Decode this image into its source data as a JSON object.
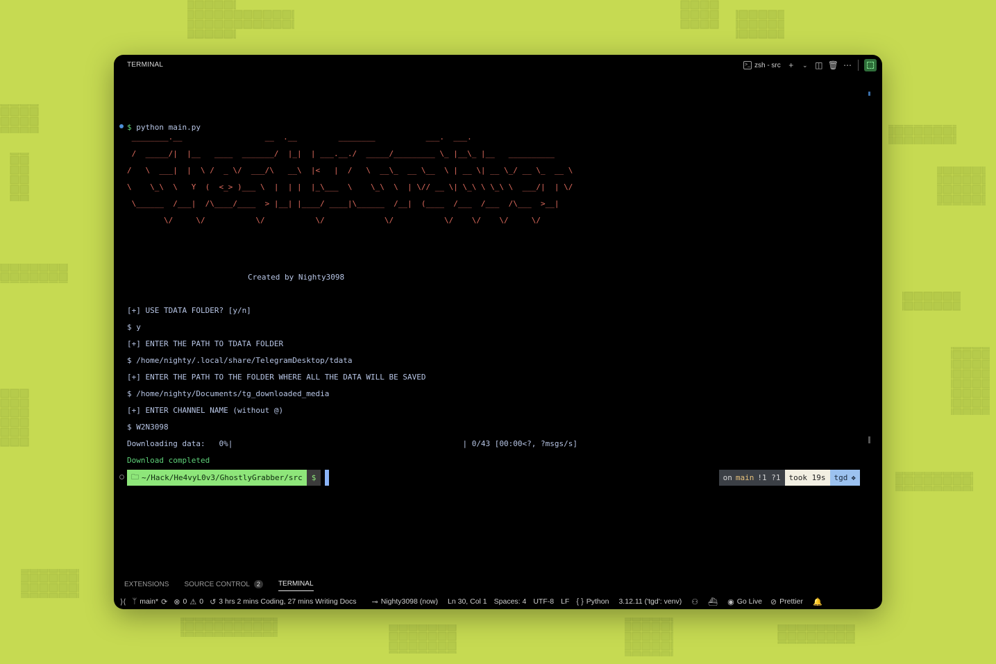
{
  "window": {
    "title": "TERMINAL"
  },
  "toolbar": {
    "terminal_name": "zsh - src",
    "add_icon": "plus-icon",
    "dropdown_icon": "chevron-down-icon",
    "split_icon": "split-icon",
    "trash_icon": "trash-icon",
    "more_icon": "more-icon",
    "maximize_icon": "maximize-icon"
  },
  "terminal": {
    "command_prompt": "$ ",
    "command": "python main.py",
    "ascii_art": " ________.__                  __  .__         ________           ___.  ___.\n /  _____/|  |__   ____  _______/  |_|  | ___.__./  _____/_________ \\_ |__\\_ |__   __________\n/   \\  ___|  |  \\ /  _ \\/  ___/\\   __\\  |<   |  /   \\  __\\_  __ \\__  \\ | __ \\| __ \\_/ __ \\_  __ \\\n\\    \\_\\  \\   Y  (  <_> )___ \\  |  | |  |_\\___  \\    \\_\\  \\  | \\// __ \\| \\_\\ \\ \\_\\ \\  ___/|  | \\/\n \\______  /___|  /\\____/____  > |__| |____/ ____|\\______  /__|  (____  /___  /___  /\\___  >__|\n        \\/     \\/           \\/           \\/             \\/           \\/    \\/    \\/     \\/",
    "credit": "Created by Nighty3098",
    "lines": [
      "[+] USE TDATA FOLDER? [y/n]",
      "$ y",
      "[+] ENTER THE PATH TO TDATA FOLDER",
      "$ /home/nighty/.local/share/TelegramDesktop/tdata",
      "[+] ENTER THE PATH TO THE FOLDER WHERE ALL THE DATA WILL BE SAVED",
      "$ /home/nighty/Documents/tg_downloaded_media",
      "[+] ENTER CHANNEL NAME (without @)",
      "$ W2N3098",
      "Downloading data:   0%|                                                  | 0/43 [00:00<?, ?msgs/s]"
    ],
    "done": "Download completed",
    "prompt_path": "~/Hack/He4vyL0v3/GhostlyGrabber/src",
    "prompt_symbol": "$",
    "right_prompt": {
      "on": "on",
      "branch": "main",
      "status": "!1 ?1",
      "took": "took 19s",
      "env": "tgd"
    }
  },
  "panels": [
    {
      "label": "EXTENSIONS",
      "badge": ""
    },
    {
      "label": "SOURCE CONTROL",
      "badge": "2"
    },
    {
      "label": "TERMINAL",
      "badge": ""
    }
  ],
  "statusbar": {
    "branch": "main*",
    "errors": "0",
    "warnings": "0",
    "time": "3 hrs 2 mins Coding, 27 mins Writing Docs",
    "user": "Nighty3098 (now)",
    "position": "Ln 30, Col 1",
    "spaces": "Spaces: 4",
    "encoding": "UTF-8",
    "eol": "LF",
    "language": "Python",
    "interpreter": "3.12.11 ('tgd': venv)",
    "golive": "Go Live",
    "prettier": "Prettier"
  }
}
